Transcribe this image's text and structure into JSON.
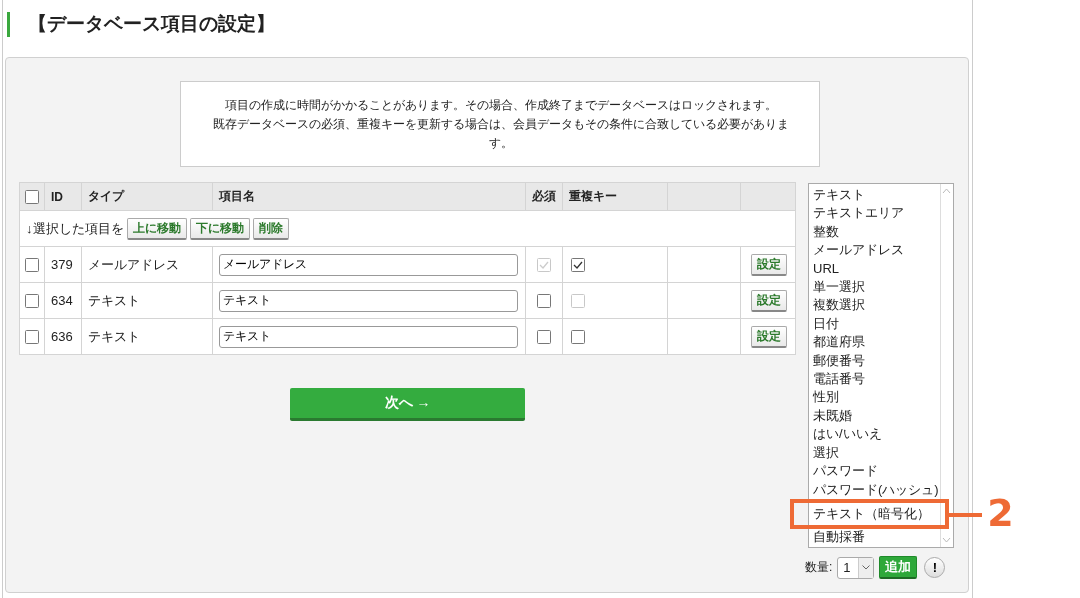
{
  "title": "【データベース項目の設定】",
  "notice": [
    "項目の作成に時間がかかることがあります。その場合、作成終了までデータベースはロックされます。",
    "既存データベースの必須、重複キーを更新する場合は、会員データもその条件に合致している必要があります。"
  ],
  "table": {
    "select_all": {
      "checked": false
    },
    "columns": [
      {
        "label": "ID"
      },
      {
        "label": "タイプ"
      },
      {
        "label": "項目名"
      },
      {
        "label": "必須"
      },
      {
        "label": "重複キー"
      }
    ],
    "bulk_label": "↓選択した項目を",
    "bulk_buttons": [
      "上に移動",
      "下に移動",
      "削除"
    ],
    "rows": [
      {
        "checked": false,
        "id": "379",
        "type": "メールアドレス",
        "name": "メールアドレス",
        "required": {
          "checked": true,
          "disabled": true
        },
        "duplicate_key": {
          "checked": true,
          "disabled": false
        },
        "button": "設定"
      },
      {
        "checked": false,
        "id": "634",
        "type": "テキスト",
        "name": "テキスト",
        "required": {
          "checked": false,
          "disabled": false
        },
        "duplicate_key": {
          "checked": false,
          "disabled": true
        },
        "button": "設定"
      },
      {
        "checked": false,
        "id": "636",
        "type": "テキスト",
        "name": "テキスト",
        "required": {
          "checked": false,
          "disabled": false
        },
        "duplicate_key": {
          "checked": false,
          "disabled": false
        },
        "button": "設定"
      }
    ]
  },
  "next_button": "次へ →",
  "type_list": {
    "items": [
      {
        "label": "テキスト",
        "selected": false
      },
      {
        "label": "テキストエリア",
        "selected": false
      },
      {
        "label": "整数",
        "selected": false
      },
      {
        "label": "メールアドレス",
        "selected": false
      },
      {
        "label": "URL",
        "selected": false
      },
      {
        "label": "単一選択",
        "selected": false
      },
      {
        "label": "複数選択",
        "selected": false
      },
      {
        "label": "日付",
        "selected": false
      },
      {
        "label": "都道府県",
        "selected": false
      },
      {
        "label": "郵便番号",
        "selected": false
      },
      {
        "label": "電話番号",
        "selected": false
      },
      {
        "label": "性別",
        "selected": false
      },
      {
        "label": "未既婚",
        "selected": false
      },
      {
        "label": "はい/いいえ",
        "selected": false
      },
      {
        "label": "選択",
        "selected": false
      },
      {
        "label": "パスワード",
        "selected": false
      },
      {
        "label": "パスワード(ハッシュ)",
        "selected": false
      },
      {
        "label": "テキスト（暗号化）",
        "selected": false,
        "highlighted": true
      },
      {
        "label": "自動採番",
        "selected": false
      }
    ]
  },
  "quantity": {
    "label": "数量:",
    "value": "1"
  },
  "add_button": "追加",
  "help_button": "!",
  "callout": {
    "label": "2"
  }
}
